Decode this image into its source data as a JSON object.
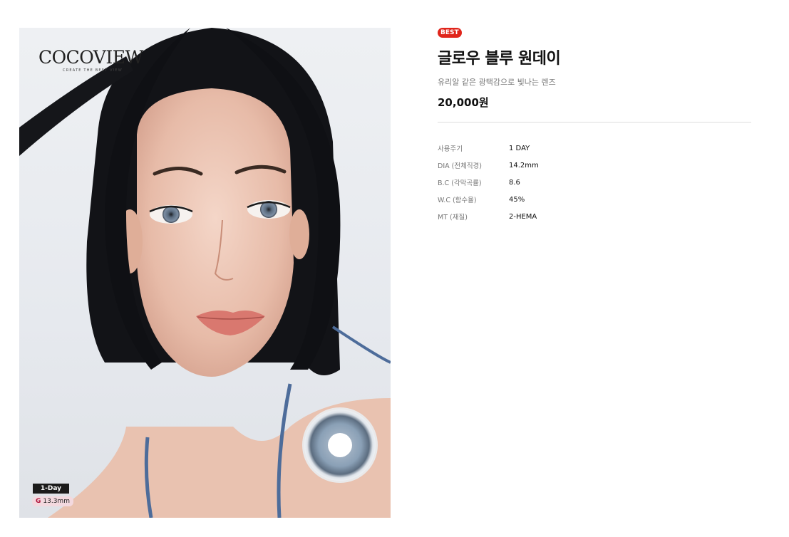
{
  "image": {
    "brand": "COCOVIEW",
    "tagline": "CREATE THE BEST VIEW",
    "type_badge": "1-Day",
    "size_badge_prefix": "G",
    "size_badge_value": "13.3mm"
  },
  "product": {
    "badge": "BEST",
    "title": "글로우 블루 원데이",
    "subtitle": "유리알 같은 광택감으로 빛나는 렌즈",
    "price": "20,000원"
  },
  "specs": [
    {
      "label": "사용주기",
      "value": "1 DAY"
    },
    {
      "label": "DIA (전체직경)",
      "value": "14.2mm"
    },
    {
      "label": "B.C (각막곡률)",
      "value": "8.6"
    },
    {
      "label": "W.C (함수율)",
      "value": "45%"
    },
    {
      "label": "MT (재질)",
      "value": "2-HEMA"
    }
  ],
  "colors": {
    "best_badge": "#e0251b",
    "size_badge_bg": "#f3d9df",
    "lens_blue": "#8fa3b8"
  }
}
